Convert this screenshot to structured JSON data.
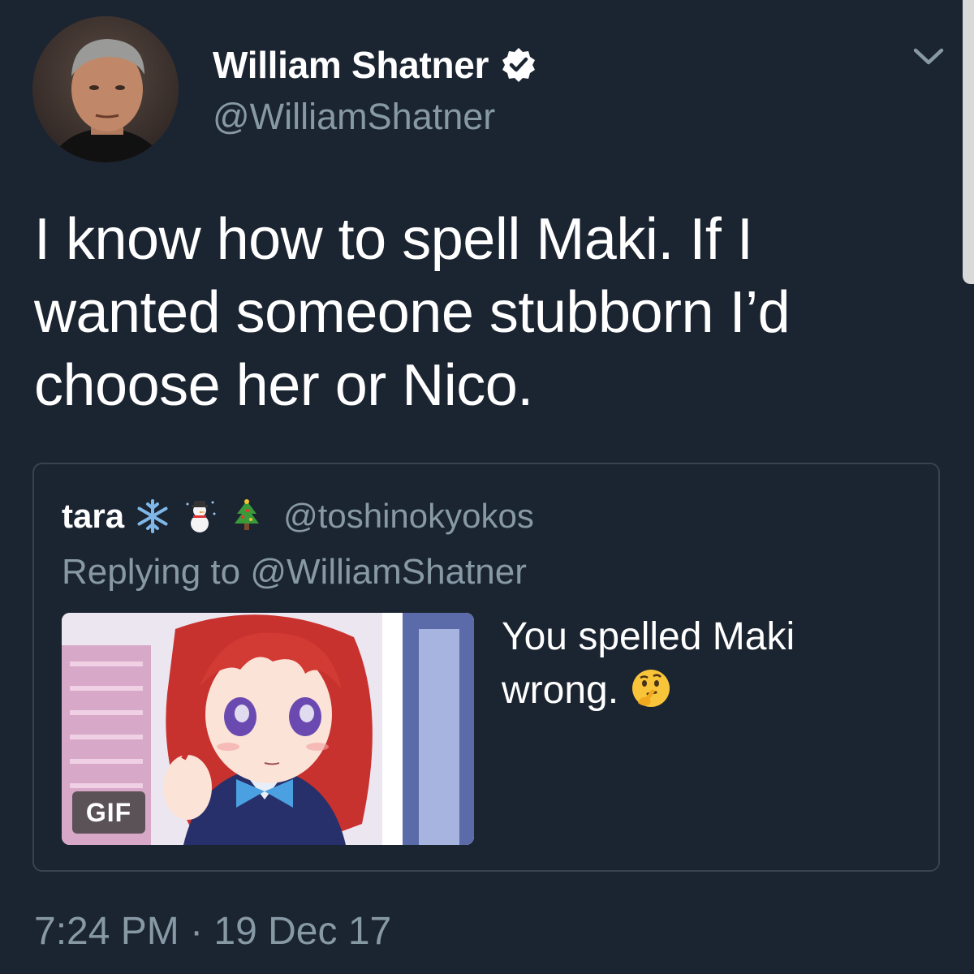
{
  "author": {
    "display_name": "William Shatner",
    "handle": "@WilliamShatner",
    "verified": true,
    "avatar_icon": "profile-photo"
  },
  "tweet": {
    "text": "I know how to spell Maki. If I wanted someone stubborn I’d choose her or Nico.",
    "timestamp": "7:24 PM · 19 Dec 17"
  },
  "quoted_tweet": {
    "display_name": "tara",
    "name_emojis": [
      "snowflake-icon",
      "snowman-icon",
      "christmas-tree-icon"
    ],
    "handle": "@toshinokyokos",
    "replying_to": "Replying to @WilliamShatner",
    "text": "You spelled Maki wrong.",
    "text_emoji": "thinking-face-icon",
    "media": {
      "type": "gif",
      "badge": "GIF"
    }
  },
  "colors": {
    "background": "#1b2431",
    "primary_text": "#ffffff",
    "secondary_text": "#8899a6",
    "card_border": "#38444d"
  }
}
